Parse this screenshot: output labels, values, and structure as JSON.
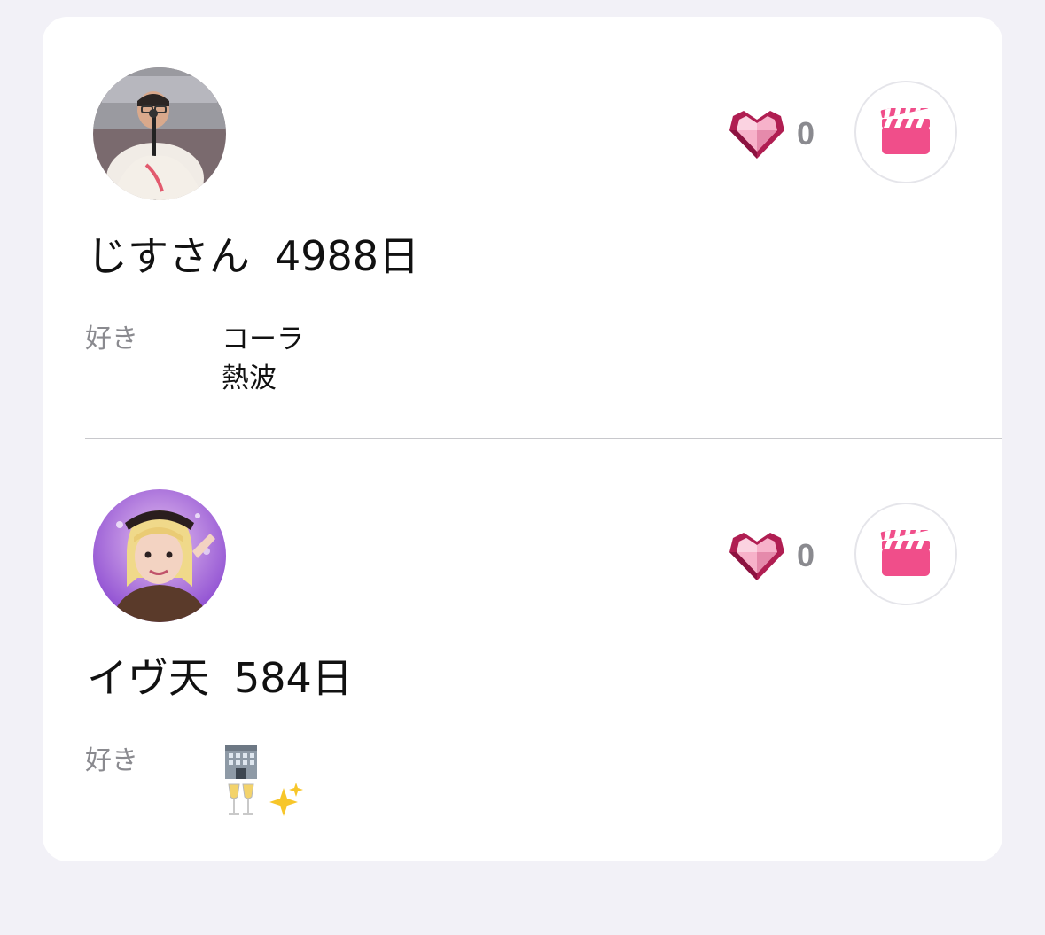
{
  "members": [
    {
      "name": "じすさん",
      "days": "4988日",
      "like_count": "0",
      "favorites_label": "好き",
      "favorites": [
        "コーラ",
        "熱波"
      ]
    },
    {
      "name": "イヴ天",
      "days": "584日",
      "like_count": "0",
      "favorites_label": "好き",
      "favorites": [
        "🏢",
        "🥂✨"
      ]
    }
  ],
  "colors": {
    "background": "#f2f1f7",
    "card": "#ffffff",
    "accent_pink": "#f04e8a",
    "heart_dark": "#b01e52",
    "muted_text": "#8a8a8f"
  },
  "icons": {
    "like": "gem-heart-icon",
    "video": "clapperboard-icon"
  }
}
